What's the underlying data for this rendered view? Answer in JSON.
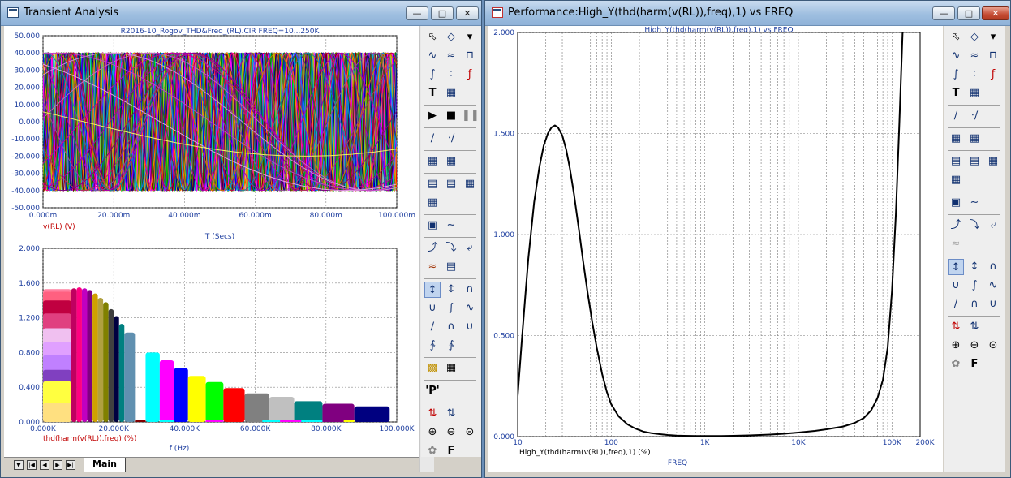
{
  "windows": {
    "transient": {
      "title": "Transient Analysis",
      "plot_title": "R2016-10_Rogov_THD&Freq_(RL).CIR FREQ=10...250K",
      "tab_label": "Main"
    },
    "performance": {
      "title": "Performance:High_Y(thd(harm(v(RL)),freq),1) vs FREQ"
    }
  },
  "chart_data": [
    {
      "type": "line",
      "title": "R2016-10_Rogov_THD&Freq_(RL).CIR FREQ=10...250K",
      "xlabel": "T (Secs)",
      "ylabel": "v(RL) (V)",
      "xlim": [
        0,
        100
      ],
      "ylim": [
        -50,
        50
      ],
      "x_ticks": [
        "0.000m",
        "20.000m",
        "40.000m",
        "60.000m",
        "80.000m",
        "100.000m"
      ],
      "y_ticks": [
        "50.000",
        "40.000",
        "30.000",
        "20.000",
        "10.000",
        "0.000",
        "-10.000",
        "-20.000",
        "-30.000",
        "-40.000",
        "-50.000"
      ],
      "grid": true,
      "amplitude": 40,
      "series_periods_ms": [
        0.5,
        0.75,
        1,
        1.3,
        1.7,
        2.2,
        2.8,
        3.5,
        4.3,
        5.2,
        6.2,
        7.4,
        8.8,
        10.5,
        12.5,
        15,
        18,
        21.5,
        26,
        31,
        37,
        44,
        52,
        62,
        74,
        88,
        104,
        124,
        148,
        176,
        210,
        250
      ],
      "last_series_amplitude": 20,
      "colors": [
        "#ff0000",
        "#00c000",
        "#0000ff",
        "#ff00ff",
        "#00c0c0",
        "#c0c000",
        "#800000",
        "#008000",
        "#000080",
        "#800080",
        "#008080",
        "#808000",
        "#ff8000",
        "#8000ff",
        "#0080ff",
        "#ff0080",
        "#c00040",
        "#404040",
        "#a000a0",
        "#d07000",
        "#2080a0",
        "#b000b0",
        "#905090",
        "#b03060",
        "#800080",
        "#a000a0",
        "#c000a0",
        "#c060c0",
        "#d090d0",
        "#c040c0",
        "#e0a0e0",
        "#f0f060"
      ]
    },
    {
      "type": "bar",
      "xlabel": "f (Hz)",
      "ylabel": "thd(harm(v(RL)),freq) (%)",
      "xlim": [
        0,
        100
      ],
      "ylim": [
        0,
        2
      ],
      "x_ticks": [
        "0.000K",
        "20.000K",
        "40.000K",
        "60.000K",
        "80.000K",
        "100.000K"
      ],
      "y_ticks": [
        "2.000",
        "1.600",
        "1.200",
        "0.800",
        "0.400",
        "0.000"
      ],
      "grid": true,
      "bars": [
        {
          "x0": 0,
          "x1": 8,
          "v": 0.22,
          "color": "#ffe080"
        },
        {
          "x0": 0,
          "x1": 8,
          "v": 0.47,
          "color": "#ffff40"
        },
        {
          "x0": 0,
          "x1": 8,
          "v": 0.6,
          "color": "#8040c0"
        },
        {
          "x0": 0,
          "x1": 8,
          "v": 0.77,
          "color": "#c080ff"
        },
        {
          "x0": 0,
          "x1": 8,
          "v": 0.92,
          "color": "#e0a0ff"
        },
        {
          "x0": 0,
          "x1": 8,
          "v": 1.08,
          "color": "#f0c0f0"
        },
        {
          "x0": 0,
          "x1": 8,
          "v": 1.25,
          "color": "#e04080"
        },
        {
          "x0": 0,
          "x1": 8,
          "v": 1.4,
          "color": "#c00040"
        },
        {
          "x0": 0,
          "x1": 8,
          "v": 1.5,
          "color": "#ff6080"
        },
        {
          "x0": 0,
          "x1": 8,
          "v": 1.53,
          "color": "#ff80a0"
        },
        {
          "x0": 8,
          "x1": 9.5,
          "v": 1.54,
          "color": "#c00060"
        },
        {
          "x0": 9.5,
          "x1": 11,
          "v": 1.55,
          "color": "#ff0080"
        },
        {
          "x0": 11,
          "x1": 12.5,
          "v": 1.54,
          "color": "#c000c0"
        },
        {
          "x0": 12.5,
          "x1": 14,
          "v": 1.52,
          "color": "#800080"
        },
        {
          "x0": 14,
          "x1": 15.5,
          "v": 1.48,
          "color": "#d0a000"
        },
        {
          "x0": 15.5,
          "x1": 17,
          "v": 1.43,
          "color": "#b0a040"
        },
        {
          "x0": 17,
          "x1": 18.5,
          "v": 1.38,
          "color": "#808000"
        },
        {
          "x0": 18.5,
          "x1": 20,
          "v": 1.3,
          "color": "#404040"
        },
        {
          "x0": 20,
          "x1": 21.5,
          "v": 1.22,
          "color": "#000040"
        },
        {
          "x0": 21.5,
          "x1": 23,
          "v": 1.13,
          "color": "#008080"
        },
        {
          "x0": 23,
          "x1": 26,
          "v": 1.03,
          "color": "#6090b0"
        },
        {
          "x0": 29,
          "x1": 33,
          "v": 0.8,
          "color": "#00ffff"
        },
        {
          "x0": 33,
          "x1": 37,
          "v": 0.71,
          "color": "#ff00ff"
        },
        {
          "x0": 37,
          "x1": 41,
          "v": 0.62,
          "color": "#0000ff"
        },
        {
          "x0": 41,
          "x1": 46,
          "v": 0.53,
          "color": "#ffff00"
        },
        {
          "x0": 46,
          "x1": 51,
          "v": 0.46,
          "color": "#00ff00"
        },
        {
          "x0": 51,
          "x1": 57,
          "v": 0.39,
          "color": "#ff0000"
        },
        {
          "x0": 57,
          "x1": 64,
          "v": 0.33,
          "color": "#808080"
        },
        {
          "x0": 64,
          "x1": 71,
          "v": 0.29,
          "color": "#c0c0c0"
        },
        {
          "x0": 71,
          "x1": 79,
          "v": 0.24,
          "color": "#008080"
        },
        {
          "x0": 79,
          "x1": 88,
          "v": 0.21,
          "color": "#800080"
        },
        {
          "x0": 88,
          "x1": 98,
          "v": 0.18,
          "color": "#000080"
        }
      ],
      "floor_segments": [
        {
          "x0": 26,
          "x1": 29,
          "color": "#800000"
        },
        {
          "x0": 33,
          "x1": 37,
          "color": "#00ffff"
        },
        {
          "x0": 46,
          "x1": 51,
          "color": "#ff00ff"
        },
        {
          "x0": 62,
          "x1": 67,
          "color": "#00ffff"
        },
        {
          "x0": 67,
          "x1": 73,
          "color": "#ff00ff"
        },
        {
          "x0": 73,
          "x1": 79,
          "color": "#00ffff"
        },
        {
          "x0": 79,
          "x1": 85,
          "color": "#800080"
        },
        {
          "x0": 85,
          "x1": 88,
          "color": "#ffff00"
        }
      ]
    },
    {
      "type": "line",
      "title": "High_Y(thd(harm(v(RL)),freq),1) vs FREQ",
      "xlabel": "FREQ",
      "ylabel": "High_Y(thd(harm(v(RL)),freq),1) (%)",
      "xscale": "log",
      "xlim": [
        10,
        200000
      ],
      "ylim": [
        0,
        2
      ],
      "x_ticks": [
        "10",
        "100",
        "1K",
        "10K",
        "100K",
        "200K"
      ],
      "y_ticks": [
        "2.000",
        "1.500",
        "1.000",
        "0.500",
        "0.000"
      ],
      "grid": true,
      "x": [
        10,
        11,
        12,
        13,
        15,
        17,
        19,
        21,
        23,
        25,
        27,
        30,
        33,
        36,
        40,
        45,
        50,
        56,
        63,
        70,
        80,
        90,
        100,
        120,
        150,
        180,
        220,
        270,
        330,
        400,
        500,
        600,
        800,
        1000,
        1500,
        2000,
        3000,
        5000,
        7000,
        10000,
        15000,
        20000,
        30000,
        40000,
        50000,
        60000,
        70000,
        80000,
        90000,
        100000,
        110000,
        120000,
        130000
      ],
      "y": [
        0.2,
        0.46,
        0.68,
        0.88,
        1.16,
        1.33,
        1.44,
        1.5,
        1.53,
        1.54,
        1.53,
        1.49,
        1.42,
        1.33,
        1.2,
        1.03,
        0.87,
        0.71,
        0.56,
        0.44,
        0.31,
        0.22,
        0.16,
        0.1,
        0.06,
        0.04,
        0.025,
        0.017,
        0.012,
        0.008,
        0.005,
        0.004,
        0.003,
        0.003,
        0.003,
        0.004,
        0.006,
        0.01,
        0.014,
        0.02,
        0.028,
        0.036,
        0.05,
        0.068,
        0.092,
        0.13,
        0.19,
        0.28,
        0.44,
        0.72,
        1.1,
        1.55,
        2.0
      ]
    }
  ]
}
